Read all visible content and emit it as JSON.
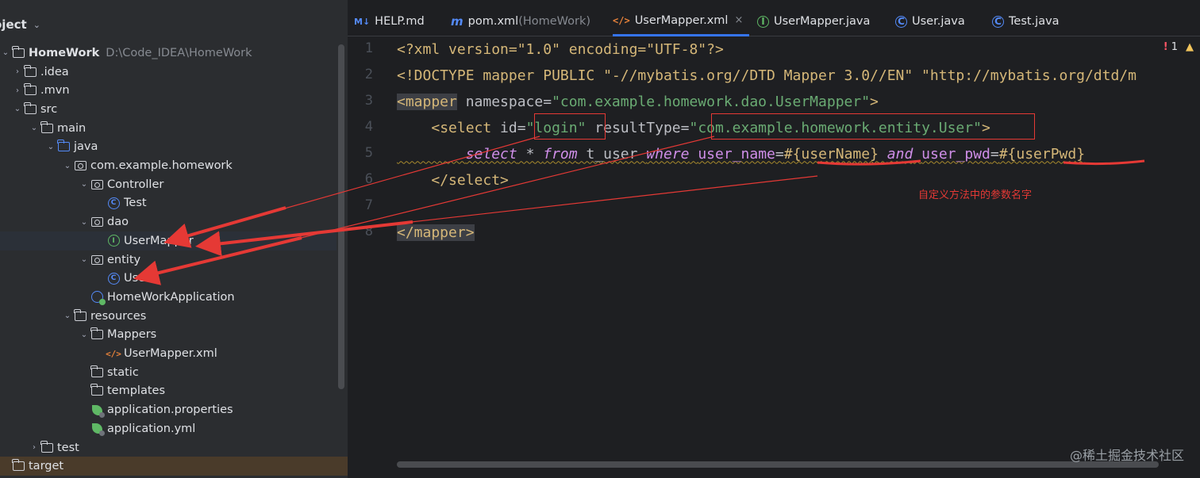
{
  "project_panel": {
    "title": "oject",
    "tree": [
      {
        "label": "HomeWork",
        "extra": "D:\\Code_IDEA\\HomeWork",
        "icon": "folder-icon",
        "arrow": "expanded"
      },
      {
        "label": ".idea",
        "icon": "folder-icon",
        "arrow": "collapsed"
      },
      {
        "label": ".mvn",
        "icon": "folder-icon",
        "arrow": "collapsed"
      },
      {
        "label": "src",
        "icon": "folder-icon",
        "arrow": "expanded"
      },
      {
        "label": "main",
        "icon": "folder-icon",
        "arrow": "expanded"
      },
      {
        "label": "java",
        "icon": "source-folder-icon",
        "arrow": "expanded"
      },
      {
        "label": "com.example.homework",
        "icon": "package-icon",
        "arrow": "expanded"
      },
      {
        "label": "Controller",
        "icon": "package-icon",
        "arrow": "expanded"
      },
      {
        "label": "Test",
        "icon": "class-icon",
        "arrow": "none"
      },
      {
        "label": "dao",
        "icon": "package-icon",
        "arrow": "expanded"
      },
      {
        "label": "UserMapper",
        "icon": "interface-icon",
        "arrow": "none"
      },
      {
        "label": "entity",
        "icon": "package-icon",
        "arrow": "expanded"
      },
      {
        "label": "User",
        "icon": "class-icon",
        "arrow": "none"
      },
      {
        "label": "HomeWorkApplication",
        "icon": "spring-app-icon",
        "arrow": "none"
      },
      {
        "label": "resources",
        "icon": "resources-folder-icon",
        "arrow": "expanded"
      },
      {
        "label": "Mappers",
        "icon": "folder-icon",
        "arrow": "expanded"
      },
      {
        "label": "UserMapper.xml",
        "icon": "xml-file-icon",
        "arrow": "none"
      },
      {
        "label": "static",
        "icon": "folder-icon",
        "arrow": "none"
      },
      {
        "label": "templates",
        "icon": "folder-icon",
        "arrow": "none"
      },
      {
        "label": "application.properties",
        "icon": "spring-config-icon",
        "arrow": "none"
      },
      {
        "label": "application.yml",
        "icon": "spring-config-icon",
        "arrow": "none"
      },
      {
        "label": "test",
        "icon": "folder-icon",
        "arrow": "collapsed"
      },
      {
        "label": "target",
        "icon": "folder-icon",
        "arrow": "none"
      }
    ]
  },
  "tabs": [
    {
      "icon_text": "M↓",
      "label": "HELP.md",
      "sub": ""
    },
    {
      "icon_text": "m",
      "label": "pom.xml",
      "sub": " (HomeWork)"
    },
    {
      "icon_text": "</>",
      "label": "UserMapper.xml",
      "sub": "",
      "close": "×"
    },
    {
      "icon_text": "I",
      "label": "UserMapper.java",
      "sub": ""
    },
    {
      "icon_text": "C",
      "label": "User.java",
      "sub": ""
    },
    {
      "icon_text": "C",
      "label": "Test.java",
      "sub": ""
    }
  ],
  "editor": {
    "line_numbers": [
      "1",
      "2",
      "3",
      "4",
      "5",
      "6",
      "7",
      "8"
    ],
    "inspections": {
      "errors": "1",
      "error_icon": "!",
      "warn_icon": "▲"
    },
    "lines": {
      "l1": {
        "a": "<?xml version=\"1.0\" encoding=\"UTF-8\"?>"
      },
      "l2": {
        "a": "<!DOCTYPE mapper PUBLIC \"-//mybatis.org//DTD Mapper 3.0//EN\" \"http://mybatis.org/dtd/m"
      },
      "l3": {
        "tag": "<mapper",
        "attr": " namespace=",
        "val": "\"com.example.homework.dao.UserMapper\"",
        "end": ">"
      },
      "l4": {
        "indent": "    ",
        "tag": "<select",
        "attr1": " id=",
        "val1": "\"login\"",
        "attr2": " resultType=",
        "val2": "\"com.example.homework.entity.User\"",
        "end": ">"
      },
      "l5": {
        "indent": "        ",
        "kw1": "select",
        "t1": " * ",
        "kw2": "from",
        "t2": " t_user ",
        "kw3": "where",
        "t3": " ",
        "col1": "user_name",
        "eq1": "=",
        "p1": "#{userName}",
        "t4": " ",
        "kw4": "and",
        "t5": " ",
        "col2": "user_pwd",
        "eq2": "=",
        "p2": "#{userPwd}"
      },
      "l6": {
        "indent": "    ",
        "tag": "</select>"
      },
      "l8": {
        "tag": "</mapper>"
      }
    }
  },
  "annotation_note": "自定义方法中的参数名字",
  "watermark": "@稀土掘金技术社区",
  "colors": {
    "annotation": "#e53935",
    "accent": "#3574f0"
  }
}
